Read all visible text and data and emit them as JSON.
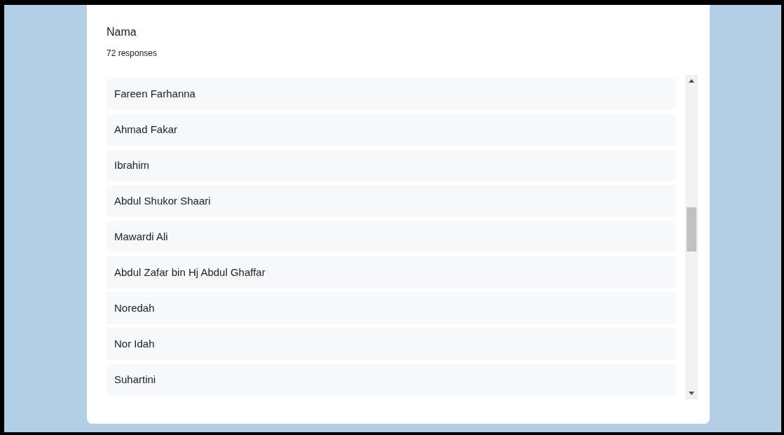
{
  "question": {
    "title": "Nama",
    "count": "72 responses"
  },
  "responses": [
    {
      "text": "Fareen Farhanna"
    },
    {
      "text": "Ahmad Fakar"
    },
    {
      "text": "Ibrahim"
    },
    {
      "text": "Abdul Shukor Shaari"
    },
    {
      "text": "Mawardi Ali"
    },
    {
      "text": "Abdul Zafar bin Hj Abdul Ghaffar"
    },
    {
      "text": "Noredah"
    },
    {
      "text": "Nor Idah"
    },
    {
      "text": "Suhartini"
    }
  ]
}
